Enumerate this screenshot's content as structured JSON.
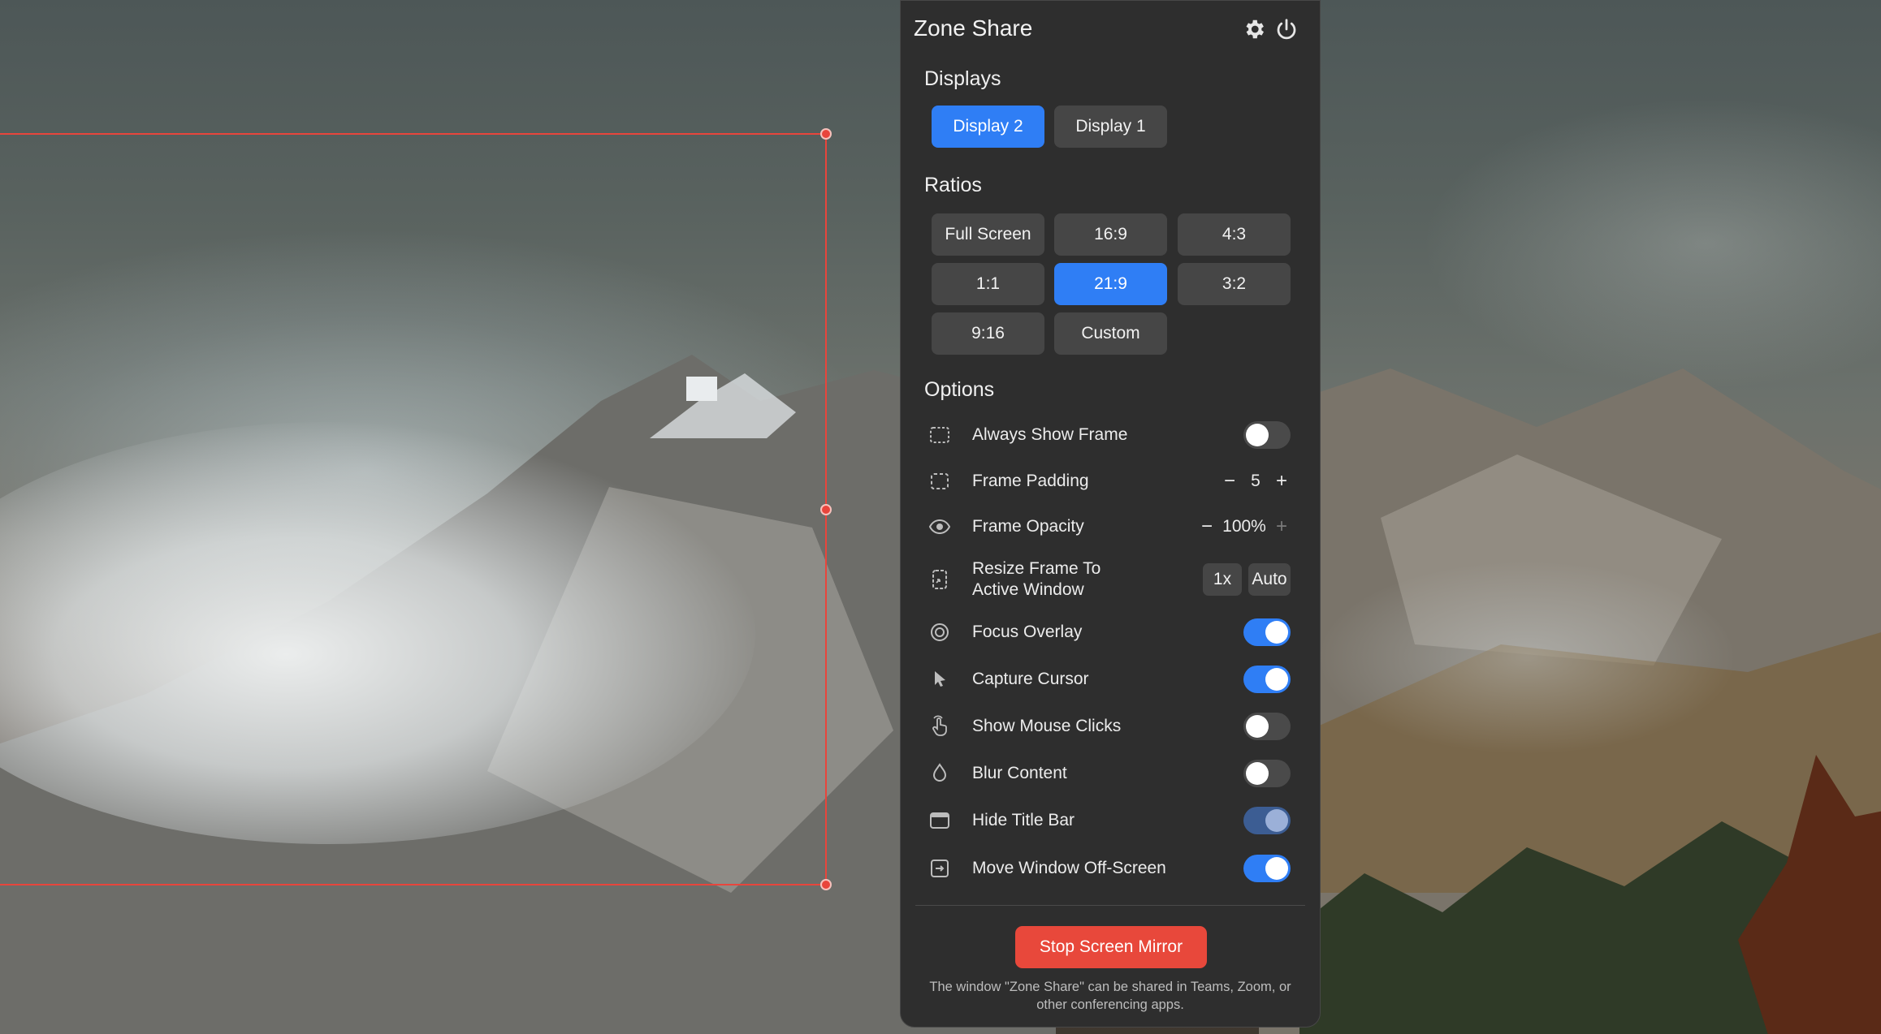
{
  "app": {
    "title": "Zone Share",
    "accent_color": "#2f7ef5",
    "stop_color": "#e8483b",
    "frame_color": "#e8453c"
  },
  "toolbar": {
    "settings_icon": "gear-icon",
    "power_icon": "power-icon"
  },
  "displays": {
    "title": "Displays",
    "items": [
      {
        "label": "Display 2",
        "selected": true
      },
      {
        "label": "Display 1",
        "selected": false
      }
    ]
  },
  "ratios": {
    "title": "Ratios",
    "items": [
      {
        "label": "Full Screen",
        "selected": false
      },
      {
        "label": "16:9",
        "selected": false
      },
      {
        "label": "4:3",
        "selected": false
      },
      {
        "label": "1:1",
        "selected": false
      },
      {
        "label": "21:9",
        "selected": true
      },
      {
        "label": "3:2",
        "selected": false
      },
      {
        "label": "9:16",
        "selected": false
      },
      {
        "label": "Custom",
        "selected": false
      }
    ]
  },
  "options": {
    "title": "Options",
    "always_show_frame": {
      "label": "Always Show Frame",
      "icon": "dashed-frame-icon",
      "on": false
    },
    "frame_padding": {
      "label": "Frame Padding",
      "icon": "padding-frame-icon",
      "value": "5",
      "dec": "−",
      "inc": "+"
    },
    "frame_opacity": {
      "label": "Frame Opacity",
      "icon": "eye-icon",
      "value": "100%",
      "dec": "−",
      "inc": "+"
    },
    "resize_frame": {
      "label_line1": "Resize Frame To",
      "label_line2": "Active Window",
      "icon": "resize-icon",
      "btn_1x": "1x",
      "btn_auto": "Auto"
    },
    "focus_overlay": {
      "label": "Focus Overlay",
      "icon": "target-icon",
      "on": true
    },
    "capture_cursor": {
      "label": "Capture Cursor",
      "icon": "cursor-icon",
      "on": true
    },
    "show_mouse_clicks": {
      "label": "Show Mouse Clicks",
      "icon": "hand-click-icon",
      "on": false
    },
    "blur_content": {
      "label": "Blur Content",
      "icon": "droplet-icon",
      "on": false
    },
    "hide_title_bar": {
      "label": "Hide Title Bar",
      "icon": "window-icon",
      "on": true
    },
    "move_window_offscreen": {
      "label": "Move Window Off-Screen",
      "icon": "move-out-icon",
      "on": true
    }
  },
  "footer": {
    "stop_label": "Stop Screen Mirror",
    "note": "The window \"Zone Share\" can be shared in Teams, Zoom, or other conferencing apps."
  }
}
